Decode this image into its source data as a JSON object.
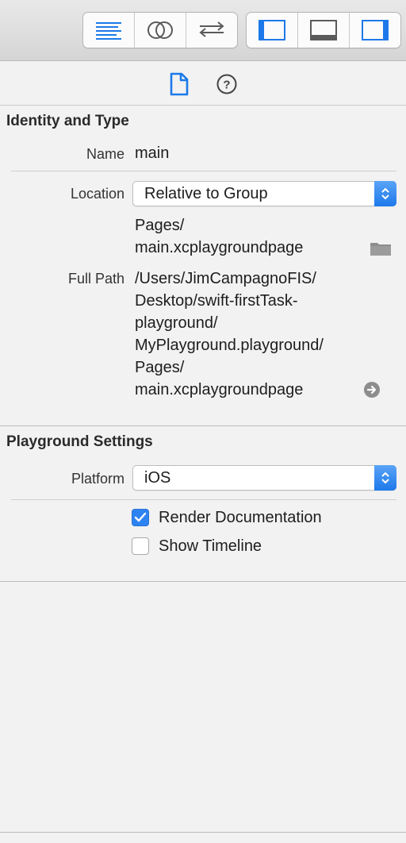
{
  "toolbar": {
    "editor_modes": [
      "standard-editor",
      "assistant-editor",
      "version-editor"
    ],
    "panels": [
      "navigator-panel",
      "debug-area-panel",
      "utilities-panel"
    ]
  },
  "inspector_tabs": [
    "file-inspector",
    "quick-help"
  ],
  "identity": {
    "title": "Identity and Type",
    "name_label": "Name",
    "name_value": "main",
    "location_label": "Location",
    "location_value": "Relative to Group",
    "location_path": [
      "Pages/",
      "main.xcplaygroundpage"
    ],
    "full_path_label": "Full Path",
    "full_path_lines": [
      "/Users/JimCampagnoFIS/",
      "Desktop/swift-firstTask-",
      "playground/",
      "MyPlayground.playground/",
      "Pages/",
      "main.xcplaygroundpage"
    ]
  },
  "playground": {
    "title": "Playground Settings",
    "platform_label": "Platform",
    "platform_value": "iOS",
    "render_doc_label": "Render Documentation",
    "render_doc_checked": true,
    "show_timeline_label": "Show Timeline",
    "show_timeline_checked": false
  },
  "colors": {
    "accent": "#2d83f2",
    "toolbar_icon": "#1d79ea"
  }
}
